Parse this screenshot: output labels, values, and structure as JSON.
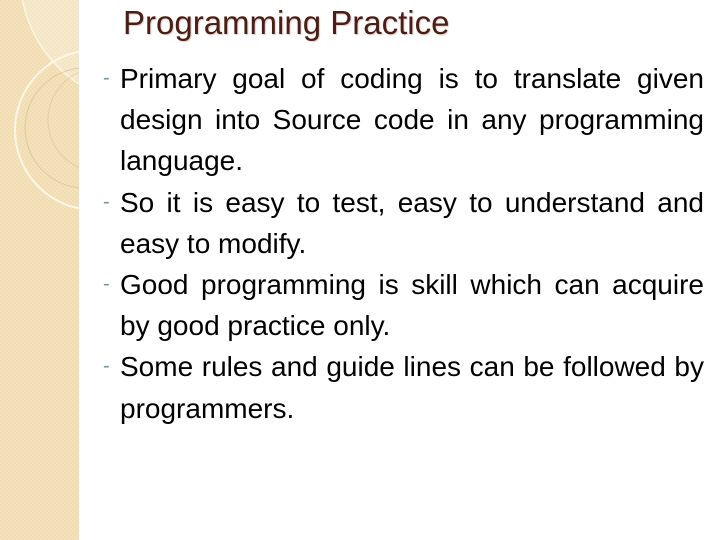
{
  "slide": {
    "title": "Programming Practice",
    "bullet_marker": "-",
    "bullets": [
      "Primary goal of coding is to translate given design into Source code in any programming language.",
      "So it is easy to test, easy to understand and easy to modify.",
      "Good programming is skill which can acquire by good practice only.",
      "Some rules and guide lines can be followed by programmers."
    ]
  },
  "colors": {
    "title": "#4a1e16",
    "body_text": "#000000",
    "bullet_marker": "#6a9aa0",
    "sidebar": "#f1dcb0",
    "background": "#ffffff"
  }
}
